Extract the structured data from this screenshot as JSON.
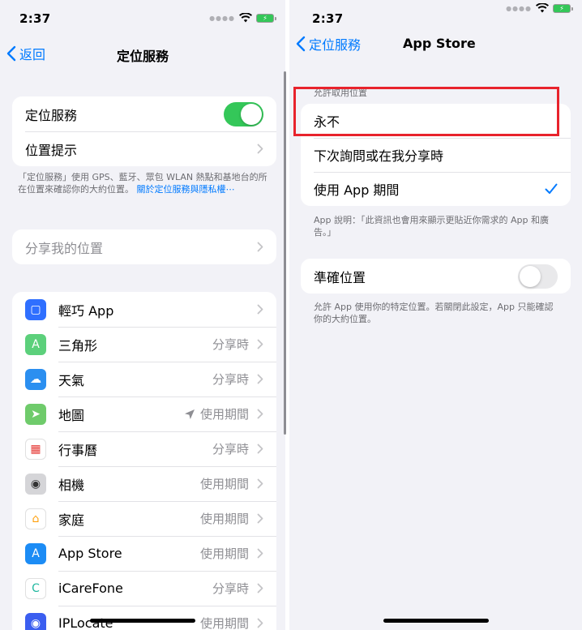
{
  "left": {
    "status_time": "2:37",
    "back_label": "返回",
    "title": "定位服務",
    "location_services_label": "定位服務",
    "location_services_on": true,
    "location_alerts_label": "位置提示",
    "location_footnote": "「定位服務」使用 GPS、藍牙、眾包 WLAN 熱點和基地台的所在位置來確認你的大約位置。",
    "location_footnote_link": "關於定位服務與隱私權⋯",
    "share_location_label": "分享我的位置",
    "apps": [
      {
        "name": "輕巧 App",
        "value": "",
        "icon": "shortcuts-app-icon",
        "color": "#2f6fff"
      },
      {
        "name": "三角形",
        "value": "分享時",
        "icon": "triangle-app-icon",
        "color": "#5cd07b"
      },
      {
        "name": "天氣",
        "value": "分享時",
        "icon": "weather-app-icon",
        "color": "#2b8ff0"
      },
      {
        "name": "地圖",
        "value": "使用期間",
        "icon": "maps-app-icon",
        "color": "#6fcb6b",
        "location_arrow": true
      },
      {
        "name": "行事曆",
        "value": "分享時",
        "icon": "calendar-app-icon",
        "color": "#ffffff"
      },
      {
        "name": "相機",
        "value": "使用期間",
        "icon": "camera-app-icon",
        "color": "#d5d5d8"
      },
      {
        "name": "家庭",
        "value": "使用期間",
        "icon": "home-app-icon",
        "color": "#ffffff"
      },
      {
        "name": "App Store",
        "value": "使用期間",
        "icon": "app-store-icon",
        "color": "#1c8cf5"
      },
      {
        "name": "iCareFone",
        "value": "分享時",
        "icon": "icarefone-app-icon",
        "color": "#ffffff"
      },
      {
        "name": "IPLocate",
        "value": "使用期間",
        "icon": "iplocate-app-icon",
        "color": "#3b5ef0"
      }
    ]
  },
  "right": {
    "status_time": "2:37",
    "back_label": "定位服務",
    "title": "App Store",
    "section_header": "允許取用位置",
    "options": [
      {
        "label": "永不",
        "selected": false
      },
      {
        "label": "下次詢問或在我分享時",
        "selected": false
      },
      {
        "label": "使用 App 期間",
        "selected": true
      }
    ],
    "app_explanation": "App 說明：「此資訊也會用來顯示更貼近你需求的 App 和廣告。」",
    "precise_location_label": "準確位置",
    "precise_location_on": false,
    "precise_footnote": "允許 App 使用你的特定位置。若關閉此設定，App 只能確認你的大約位置。"
  },
  "colors": {
    "accent": "#007aff",
    "toggle_on": "#34c759",
    "highlight": "#e8232c"
  }
}
